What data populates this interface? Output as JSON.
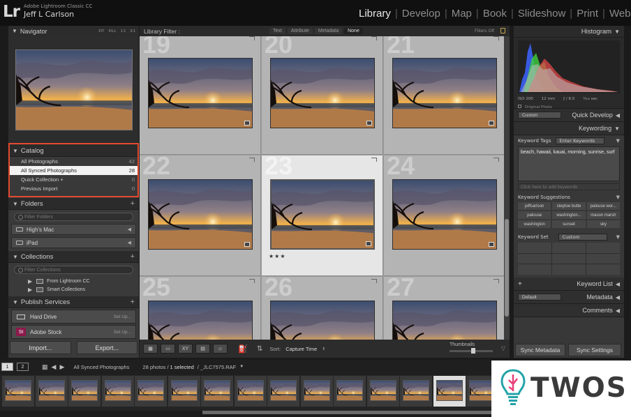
{
  "app": {
    "logo": "Lr",
    "name": "Adobe Lightroom Classic CC",
    "user": "Jeff L Carlson"
  },
  "modules": [
    "Library",
    "Develop",
    "Map",
    "Book",
    "Slideshow",
    "Print",
    "Web"
  ],
  "active_module": "Library",
  "navigator": {
    "title": "Navigator",
    "zoom": [
      "FIT",
      "FILL",
      "1:1",
      "3:1"
    ]
  },
  "catalog": {
    "title": "Catalog",
    "items": [
      {
        "label": "All Photographs",
        "count": "42"
      },
      {
        "label": "All Synced Photographs",
        "count": "28"
      },
      {
        "label": "Quick Collection +",
        "count": "0"
      },
      {
        "label": "Previous Import",
        "count": "0"
      }
    ]
  },
  "folders": {
    "title": "Folders",
    "filter_placeholder": "Filter Folders",
    "volumes": [
      "High's Mac",
      "iPad"
    ]
  },
  "collections": {
    "title": "Collections",
    "filter_placeholder": "Filter Collections",
    "items": [
      "From Lightroom CC",
      "Smart Collections"
    ]
  },
  "publish": {
    "title": "Publish Services",
    "items": [
      {
        "label": "Hard Drive",
        "action": "Set Up..."
      },
      {
        "label": "Adobe Stock",
        "action": "Set Up...",
        "icon": "St"
      }
    ]
  },
  "buttons": {
    "import": "Import...",
    "export": "Export..."
  },
  "library_filter": {
    "label": "Library Filter :",
    "options": [
      "Text",
      "Attribute",
      "Metadata",
      "None"
    ],
    "active": "None",
    "status": "Filters Off"
  },
  "grid": {
    "cells": [
      {
        "num": "19",
        "stars": "",
        "selected": false
      },
      {
        "num": "20",
        "stars": "",
        "selected": false
      },
      {
        "num": "21",
        "stars": "",
        "selected": false
      },
      {
        "num": "22",
        "stars": "",
        "selected": false
      },
      {
        "num": "23",
        "stars": "★★★",
        "selected": true
      },
      {
        "num": "24",
        "stars": "",
        "selected": false
      },
      {
        "num": "25",
        "stars": "",
        "selected": false
      },
      {
        "num": "26",
        "stars": "",
        "selected": false
      },
      {
        "num": "27",
        "stars": "",
        "selected": false
      }
    ]
  },
  "toolbar": {
    "sort_label": "Sort:",
    "sort_value": "Capture Time",
    "thumbnails_label": "Thumbnails",
    "thumbnail_size": 0.55
  },
  "histogram": {
    "title": "Histogram",
    "iso": "ISO 200",
    "focal": "12 mm",
    "aperture": "ƒ / 8.0",
    "shutter": "¹⁄₁₀₀ sec",
    "original_label": "Original Photo"
  },
  "right_panels": {
    "quick_develop": {
      "title": "Quick Develop",
      "preset": "Custom"
    },
    "keywording": {
      "title": "Keywording",
      "tags_label": "Keyword Tags",
      "tags_mode": "Enter Keywords",
      "keywords": "beach, hawaii, kauai, morning, sunrise, surf",
      "add_placeholder": "Click here to add keywords",
      "suggestions_label": "Keyword Suggestions",
      "suggestions": [
        "jeffcarlson",
        "steptoe butte",
        "palouse wor...",
        "palouse",
        "washington...",
        "mason marsh",
        "washington",
        "sunset",
        "sky"
      ],
      "set_label": "Keyword Set",
      "set_value": "Custom"
    },
    "keyword_list": {
      "title": "Keyword List"
    },
    "metadata": {
      "title": "Metadata",
      "preset": "Default"
    },
    "comments": {
      "title": "Comments"
    },
    "sync_metadata": "Sync Metadata",
    "sync_settings": "Sync Settings"
  },
  "filmstrip": {
    "pages": [
      "1",
      "2"
    ],
    "source": "All Synced Photographs",
    "count_text": "28 photos /",
    "selected_text": "1 selected",
    "filename": "/ _JLC7575.RAF",
    "frames": 15,
    "selected_index": 13
  },
  "watermark": {
    "text": "TWOS"
  },
  "colors": {
    "highlight_outline": "#e24a2f",
    "watermark_teal": "#23a3a8"
  }
}
